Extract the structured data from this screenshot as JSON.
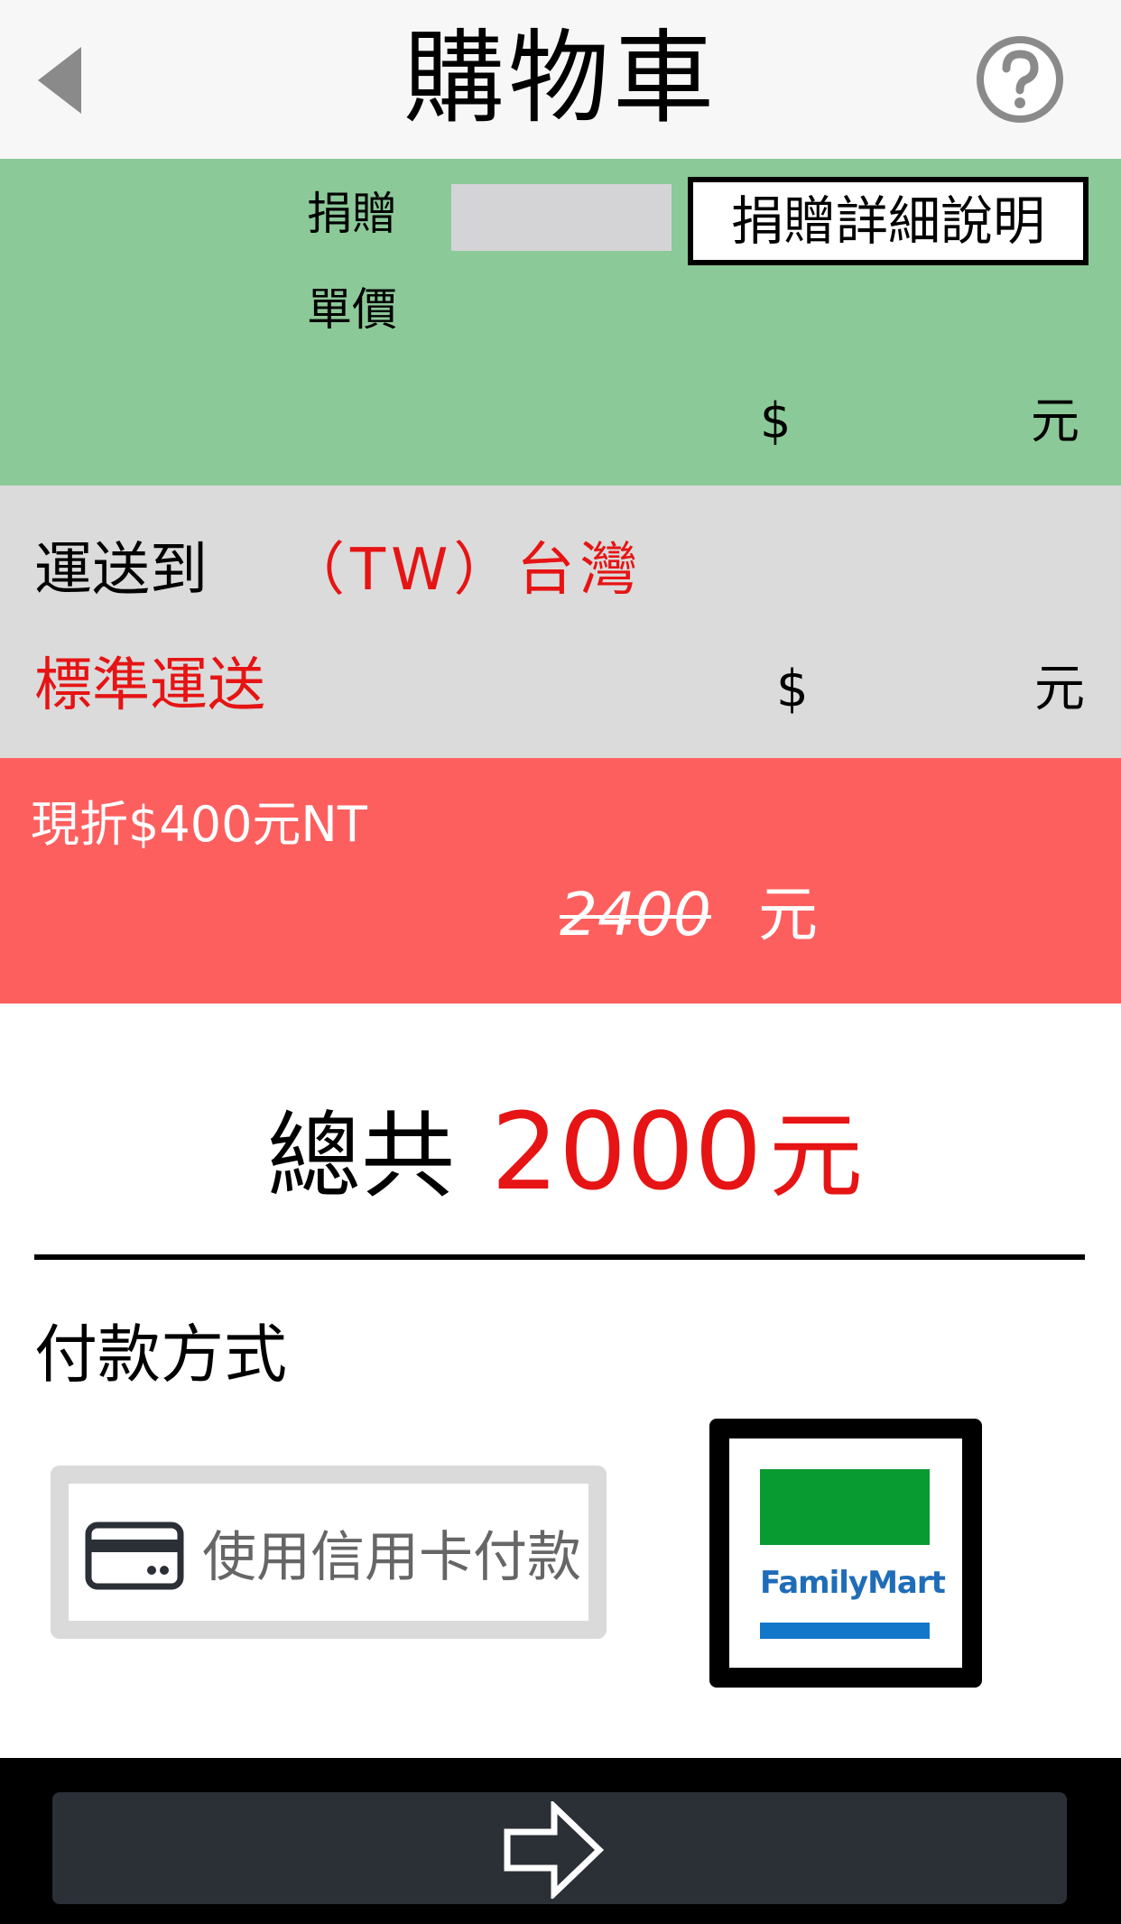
{
  "header": {
    "title": "購物車",
    "back_icon": "chevron-left-icon",
    "help_icon": "question-circle-icon"
  },
  "donation": {
    "label": "捐贈",
    "input_value": "",
    "detail_button": "捐贈詳細說明",
    "unit_price_label": "單價",
    "currency_symbol": "$",
    "yuan": "元",
    "bg_color": "#8cc998"
  },
  "shipping": {
    "to_label": "運送到",
    "country": "（TW）台灣",
    "method": "標準運送",
    "currency_symbol": "$",
    "yuan": "元",
    "bg_color": "#dbdbdb",
    "accent_color": "#e61414"
  },
  "discount": {
    "text": "現折$400元NT",
    "original_price": "2400",
    "yuan": "元",
    "bg_color": "#fd5f5f"
  },
  "total": {
    "label": "總共",
    "value": "2000",
    "yuan": "元"
  },
  "payment": {
    "label": "付款方式",
    "card_button_label": "使用信用卡付款",
    "card_icon": "credit-card-icon",
    "familymart_label": "FamilyMart",
    "familymart_colors": {
      "green": "#079b32",
      "blue": "#1377c9"
    }
  },
  "footer": {
    "next_icon": "arrow-right-icon"
  }
}
